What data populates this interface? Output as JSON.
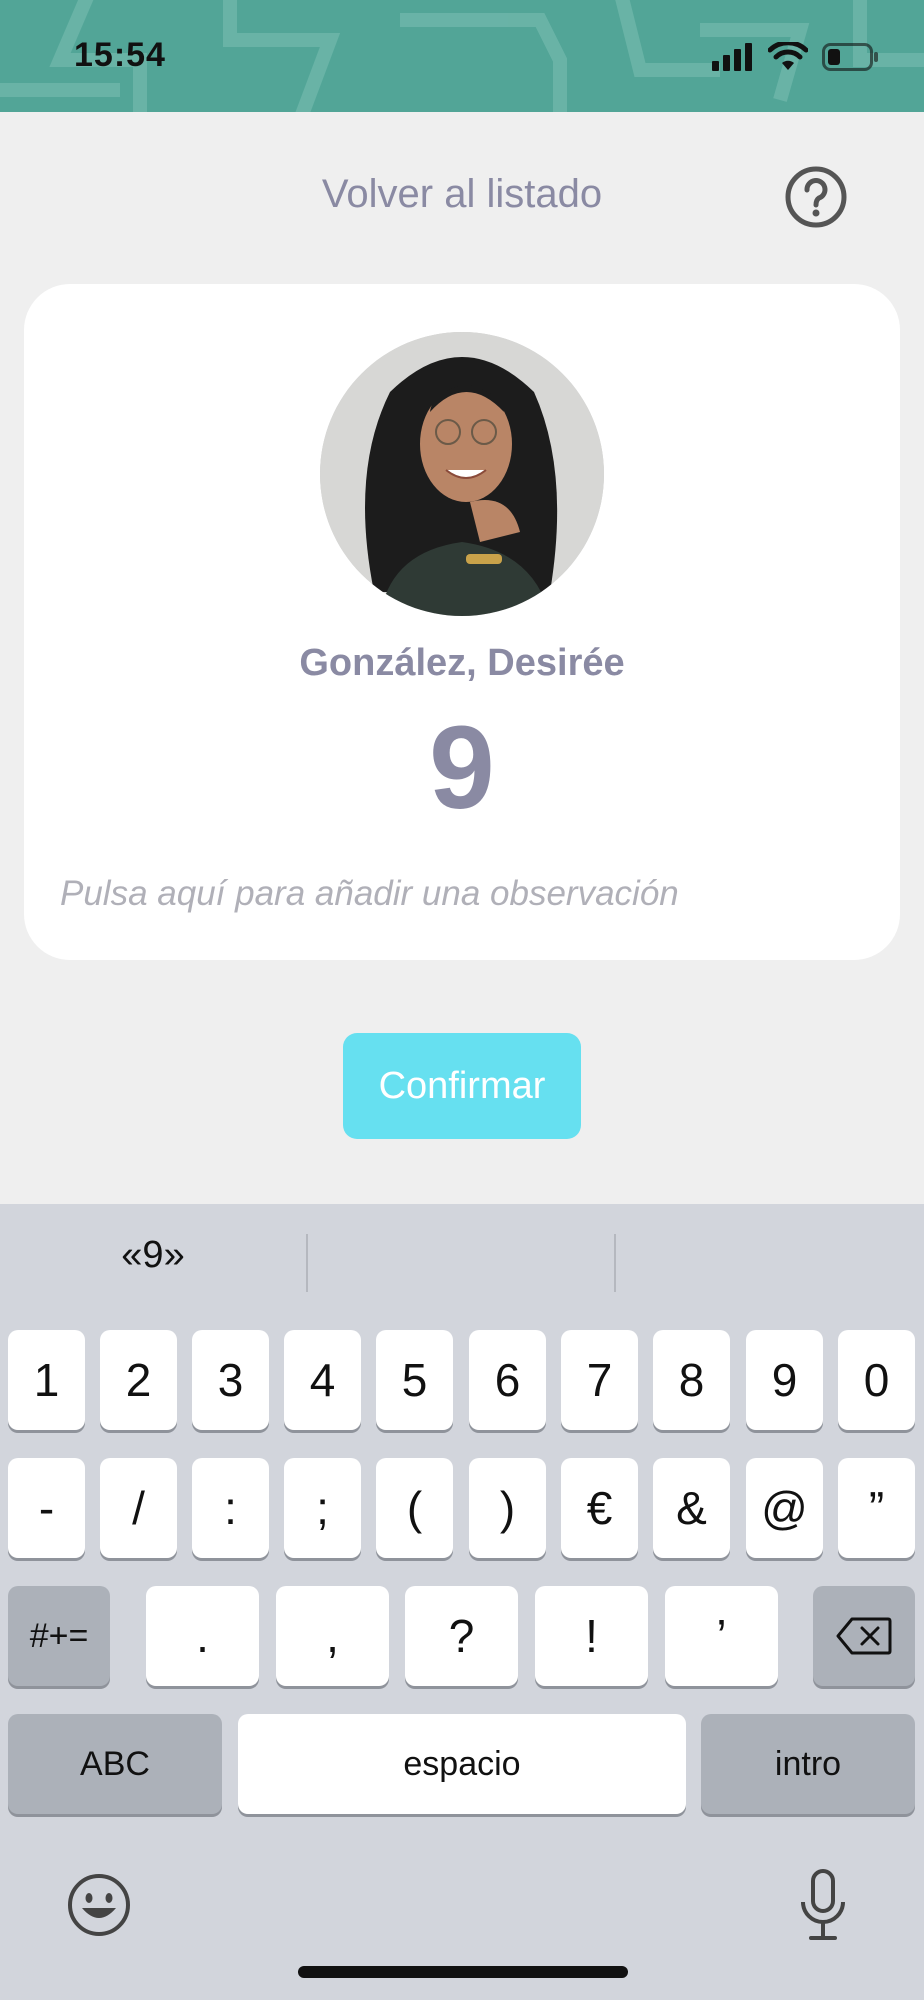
{
  "status_bar": {
    "time": "15:54",
    "background": "#52a597"
  },
  "header": {
    "back_label": "Volver al listado",
    "help_icon": "question-circle-icon"
  },
  "card": {
    "student_name": "González, Desirée",
    "grade": "9",
    "observation_placeholder": "Pulsa aquí para añadir una observación"
  },
  "confirm": {
    "label": "Confirmar",
    "color": "#66e0f0"
  },
  "keyboard": {
    "suggestions": [
      "«9»",
      "",
      ""
    ],
    "row1": [
      "1",
      "2",
      "3",
      "4",
      "5",
      "6",
      "7",
      "8",
      "9",
      "0"
    ],
    "row2": [
      "-",
      "/",
      ":",
      ";",
      "(",
      ")",
      "€",
      "&",
      "@",
      "”"
    ],
    "row3": {
      "toggle": "#+=",
      "keys": [
        ".",
        ",",
        "?",
        "!",
        "’"
      ],
      "delete_icon": "backspace-icon"
    },
    "row4": {
      "abc": "ABC",
      "space": "espacio",
      "return": "intro"
    },
    "bottom": {
      "emoji_icon": "emoji-icon",
      "mic_icon": "microphone-icon"
    }
  }
}
